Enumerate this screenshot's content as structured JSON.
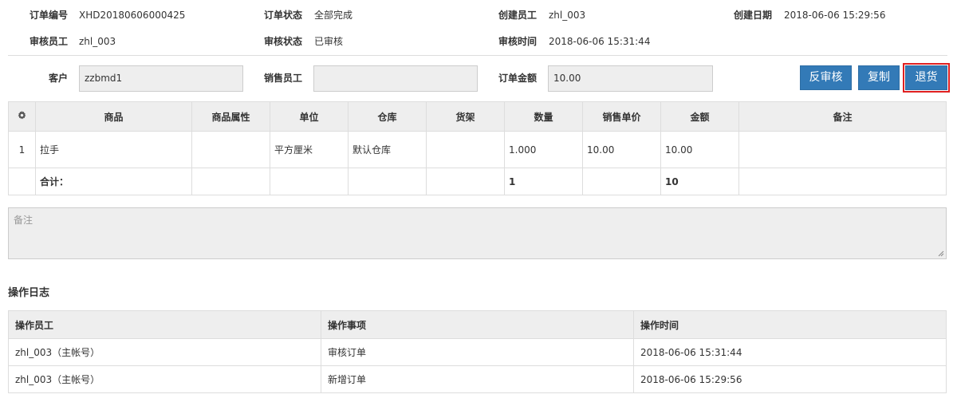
{
  "order": {
    "no_label": "订单编号",
    "no_value": "XHD20180606000425",
    "status_label": "订单状态",
    "status_value": "全部完成",
    "creator_label": "创建员工",
    "creator_value": "zhl_003",
    "date_label": "创建日期",
    "date_value": "2018-06-06 15:29:56",
    "reviewer_label": "审核员工",
    "reviewer_value": "zhl_003",
    "review_status_label": "审核状态",
    "review_status_value": "已审核",
    "review_time_label": "审核时间",
    "review_time_value": "2018-06-06 15:31:44"
  },
  "form": {
    "customer_label": "客户",
    "customer_value": "zzbmd1",
    "sales_label": "销售员工",
    "sales_value": "",
    "amount_label": "订单金额",
    "amount_value": "10.00"
  },
  "buttons": {
    "unreview": "反审核",
    "copy": "复制",
    "return": "退货"
  },
  "colors": {
    "button": "#337ab7",
    "highlight": "#e02020"
  },
  "items_table": {
    "headers": [
      "商品",
      "商品属性",
      "单位",
      "仓库",
      "货架",
      "数量",
      "销售单价",
      "金额",
      "备注"
    ],
    "rows": [
      {
        "idx": "1",
        "product": "拉手",
        "attr": "",
        "unit": "平方厘米",
        "warehouse": "默认仓库",
        "shelf": "",
        "qty": "1.000",
        "price": "10.00",
        "amount": "10.00",
        "remark": ""
      }
    ],
    "total": {
      "label": "合计：",
      "qty": "1",
      "amount": "10"
    }
  },
  "remark_placeholder": "备注",
  "log": {
    "title": "操作日志",
    "headers": [
      "操作员工",
      "操作事项",
      "操作时间"
    ],
    "rows": [
      {
        "user": "zhl_003（主帐号）",
        "action": "审核订单",
        "time": "2018-06-06 15:31:44"
      },
      {
        "user": "zhl_003（主帐号）",
        "action": "新增订单",
        "time": "2018-06-06 15:29:56"
      }
    ]
  }
}
